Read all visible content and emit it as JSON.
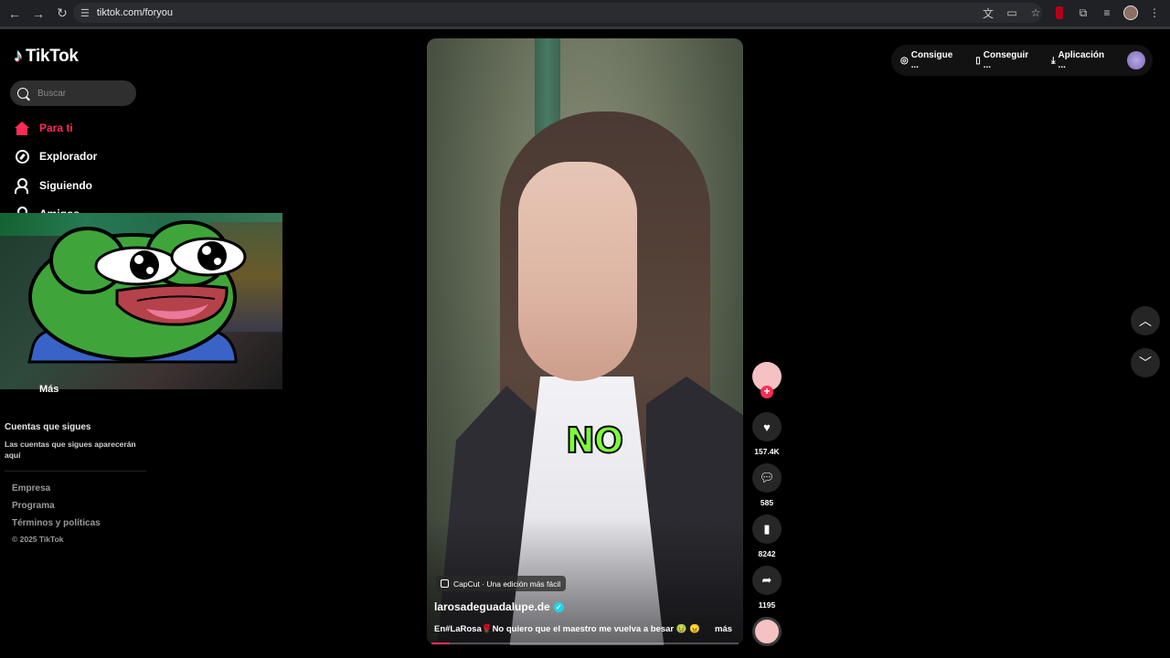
{
  "browser": {
    "url": "tiktok.com/foryou"
  },
  "brand": {
    "name": "TikTok"
  },
  "search": {
    "placeholder": "Buscar"
  },
  "nav": [
    {
      "label": "Para ti",
      "icon": "home-icon",
      "active": true
    },
    {
      "label": "Explorador",
      "icon": "compass-icon"
    },
    {
      "label": "Siguiendo",
      "icon": "following-icon"
    },
    {
      "label": "Amigos",
      "icon": "friends-icon"
    }
  ],
  "more_label": "Más",
  "following_section": {
    "title": "Cuentas que sigues",
    "description": "Las cuentas que sigues aparecerán aquí"
  },
  "footer": {
    "links": [
      "Empresa",
      "Programa",
      "Términos y políticas"
    ],
    "copyright": "© 2025 TikTok"
  },
  "video": {
    "caption_word": "NO",
    "capcut_label": "CapCut · Una edición más fácil",
    "author": "larosadeguadalupe.de",
    "description": "En#LaRosa🌹No quiero que el maestro me vuelva a besar 🤢 😠 ...",
    "more_label": "más",
    "progress_fraction": 0.06
  },
  "actions": {
    "likes": "157.4K",
    "comments": "585",
    "saves": "8242",
    "shares": "1195"
  },
  "topbar": {
    "item1": "Consigue ...",
    "item2": "Conseguir ...",
    "item3": "Aplicación ..."
  },
  "colors": {
    "accent": "#fe2c55",
    "caption": "#7cff3a",
    "verified": "#20d5ec"
  }
}
